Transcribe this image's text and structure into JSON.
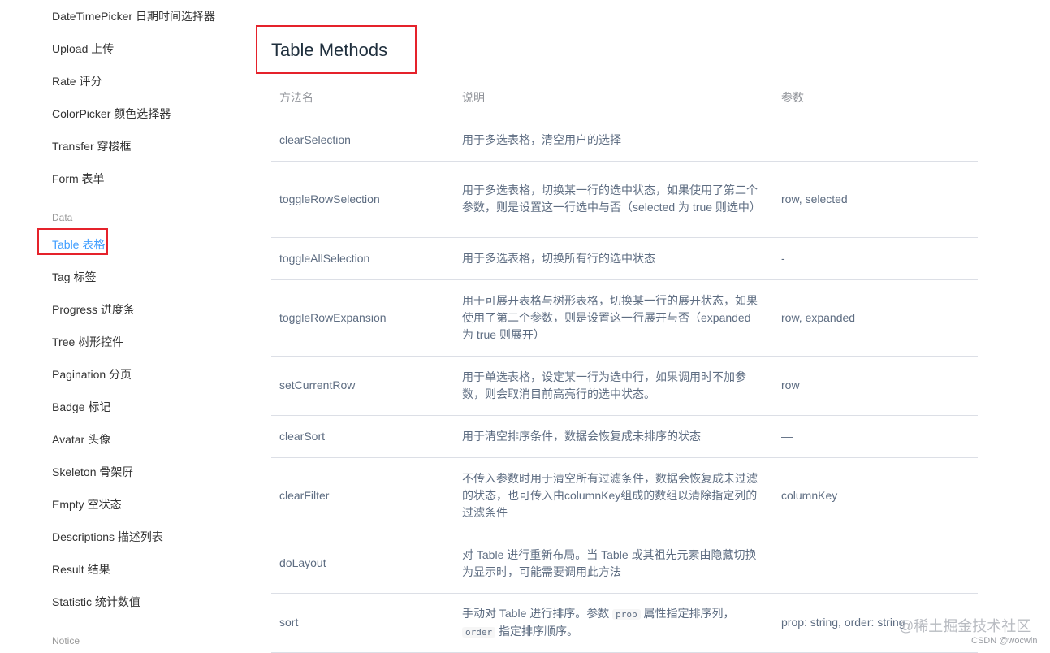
{
  "sidebar": {
    "items_top": [
      "DateTimePicker 日期时间选择器",
      "Upload 上传",
      "Rate 评分",
      "ColorPicker 颜色选择器",
      "Transfer 穿梭框",
      "Form 表单"
    ],
    "group_data": "Data",
    "items_data": [
      "Table 表格",
      "Tag 标签",
      "Progress 进度条",
      "Tree 树形控件",
      "Pagination 分页",
      "Badge 标记",
      "Avatar 头像",
      "Skeleton 骨架屏",
      "Empty 空状态",
      "Descriptions 描述列表",
      "Result 结果",
      "Statistic 统计数值"
    ],
    "group_notice": "Notice",
    "active_item": "Table 表格",
    "accent_color": "#409eff",
    "highlight_color": "#e5222b"
  },
  "main": {
    "title": "Table Methods",
    "table": {
      "headers": [
        "方法名",
        "说明",
        "参数"
      ],
      "rows": [
        {
          "name": "clearSelection",
          "desc": "用于多选表格，清空用户的选择",
          "params": "—"
        },
        {
          "name": "toggleRowSelection",
          "desc": "用于多选表格，切换某一行的选中状态，如果使用了第二个参数，则是设置这一行选中与否（selected 为 true 则选中）",
          "params": "row, selected"
        },
        {
          "name": "toggleAllSelection",
          "desc": "用于多选表格，切换所有行的选中状态",
          "params": "-"
        },
        {
          "name": "toggleRowExpansion",
          "desc": "用于可展开表格与树形表格，切换某一行的展开状态，如果使用了第二个参数，则是设置这一行展开与否（expanded 为 true 则展开）",
          "params": "row, expanded"
        },
        {
          "name": "setCurrentRow",
          "desc": "用于单选表格，设定某一行为选中行，如果调用时不加参数，则会取消目前高亮行的选中状态。",
          "params": "row"
        },
        {
          "name": "clearSort",
          "desc": "用于清空排序条件，数据会恢复成未排序的状态",
          "params": "—"
        },
        {
          "name": "clearFilter",
          "desc": "不传入参数时用于清空所有过滤条件，数据会恢复成未过滤的状态，也可传入由columnKey组成的数组以清除指定列的过滤条件",
          "params": "columnKey"
        },
        {
          "name": "doLayout",
          "desc": "对 Table 进行重新布局。当 Table 或其祖先元素由隐藏切换为显示时，可能需要调用此方法",
          "params": "—"
        },
        {
          "name": "sort",
          "desc_parts": [
            "手动对 Table 进行排序。参数 ",
            "prop",
            " 属性指定排序列，",
            "order",
            " 指定排序顺序。"
          ],
          "params": "prop: string, order: string"
        }
      ]
    }
  },
  "watermark": {
    "line1": "@稀土掘金技术社区",
    "line2": "CSDN @wocwin"
  }
}
